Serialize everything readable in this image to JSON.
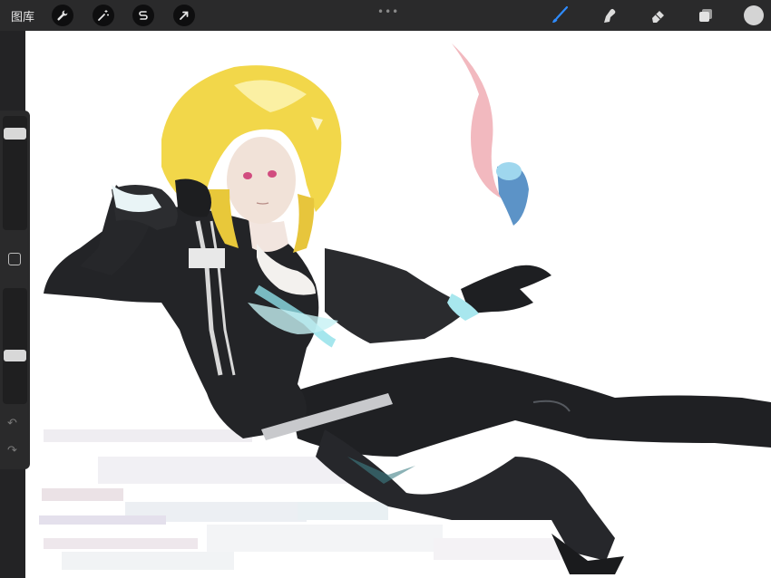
{
  "topbar": {
    "gallery_label": "图库",
    "left_tools": [
      {
        "name": "actions",
        "icon": "wrench-icon"
      },
      {
        "name": "adjustments",
        "icon": "magic-wand-icon"
      },
      {
        "name": "selection",
        "icon": "selection-s-icon"
      },
      {
        "name": "transform",
        "icon": "arrow-cursor-icon"
      }
    ],
    "right_tools": [
      {
        "name": "brush",
        "icon": "brush-icon",
        "active": true
      },
      {
        "name": "smudge",
        "icon": "smudge-finger-icon"
      },
      {
        "name": "eraser",
        "icon": "eraser-icon"
      },
      {
        "name": "layers",
        "icon": "layers-icon"
      }
    ],
    "more_icon": "ellipsis-icon",
    "color": "#d4d4d4",
    "accent": "#2f8cff"
  },
  "sidebar": {
    "brush_size_level": 0.95,
    "opacity_level": 0.35,
    "undo_icon": "undo-icon",
    "redo_icon": "redo-icon"
  },
  "canvas": {
    "background": "#ffffff",
    "content": "illustration-blonde-figure"
  }
}
